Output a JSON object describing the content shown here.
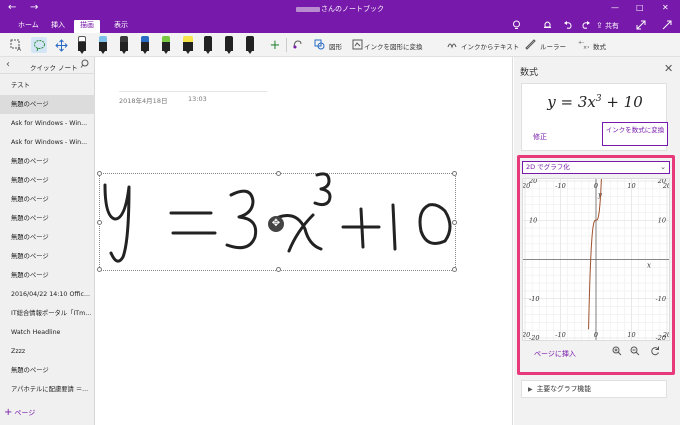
{
  "window": {
    "title_suffix": "さんのノートブック",
    "back_glyph": "←",
    "forward_glyph": "→",
    "minimize_glyph": "—",
    "maximize_glyph": "□",
    "close_glyph": "✕"
  },
  "ribbon": {
    "tabs": [
      "ホーム",
      "挿入",
      "描画",
      "表示"
    ],
    "active_tab": "描画",
    "share_label": "共有",
    "right_icons": [
      "lightbulb-icon",
      "bell-icon",
      "undo-icon",
      "redo-icon",
      "share-icon",
      "fullscreen-icon"
    ]
  },
  "toolbar": {
    "pen_colors": [
      "#ffffff",
      "#7ec0e8",
      "#3a3a3a",
      "#2a6cc4",
      "#7ac943",
      "#f7e34a",
      "#222222",
      "#222222",
      "#222222",
      "#222222",
      "#222222"
    ],
    "add_pen": "+",
    "shapes_label": "図形",
    "ink_to_shape_label": "インクを図形に変換",
    "ink_to_text_label": "インクからテキスト",
    "ruler_label": "ルーラー",
    "math_label": "数式"
  },
  "leftpane": {
    "section": "クイック ノート",
    "pages": [
      "テスト",
      "無題のページ",
      "Ask for Windows - Win...",
      "Ask for Windows - Win...",
      "無題のページ",
      "無題のページ",
      "無題のページ",
      "無題のページ",
      "無題のページ",
      "無題のページ",
      "無題のページ",
      "2016/04/22 14:10 Offic...",
      "IT総合情報ポータル「ITm...",
      "Watch Headline",
      "Zzzz",
      "無題のページ",
      "アパホテルに配慮要請 ＝..."
    ],
    "selected_index": 1,
    "add_page": "ページ"
  },
  "canvas": {
    "date": "2018年4月18日",
    "time": "13:03"
  },
  "math_pane": {
    "title": "数式",
    "equation_lhs": "y = 3x",
    "equation_exp": "3",
    "equation_rhs": " + 10",
    "fix_label": "修正",
    "convert_label": "インクを数式に変換",
    "graph_mode": "2D でグラフ化",
    "insert_label": "ページに挿入",
    "main_features_label": "主要なグラフ機能"
  },
  "chart_data": {
    "type": "line",
    "xlim": [
      -20,
      20
    ],
    "ylim": [
      -20,
      20
    ],
    "xticks": [
      -20,
      -10,
      0,
      10,
      20
    ],
    "yticks": [
      -20,
      -10,
      10,
      20
    ],
    "xlabel": "x",
    "ylabel": "y",
    "grid": true,
    "function": "y = 3x^3 + 10",
    "x": [
      -1.7,
      -1.6,
      -1.5,
      -1.4,
      -1.3,
      -1.2,
      -1.1,
      -1.0,
      -0.9,
      -0.8,
      -0.6,
      -0.4,
      -0.2,
      0,
      0.2,
      0.4,
      0.6,
      0.8,
      0.9,
      1.0,
      1.1,
      1.2,
      1.3
    ],
    "y": [
      -4.74,
      -2.29,
      -0.13,
      1.77,
      3.41,
      4.82,
      6.01,
      7.0,
      7.81,
      8.46,
      9.35,
      9.81,
      9.98,
      10.0,
      10.02,
      10.19,
      10.65,
      11.54,
      12.19,
      13.0,
      13.99,
      15.18,
      16.59
    ],
    "line_color": "#a0522d"
  }
}
